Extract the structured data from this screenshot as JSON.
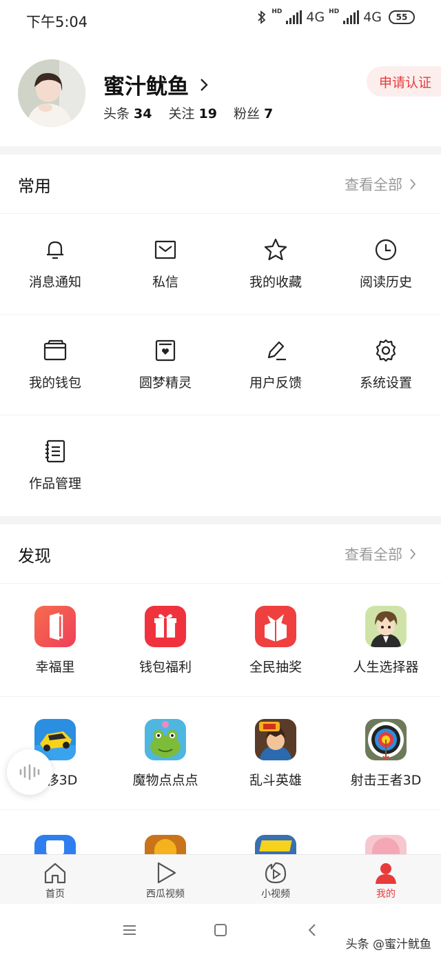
{
  "status_bar": {
    "time": "下午5:04",
    "hd1": "HD",
    "net1": "4G",
    "hd2": "HD",
    "net2": "4G",
    "battery": "55"
  },
  "profile": {
    "name": "蜜汁鱿鱼",
    "verify_label": "申请认证",
    "stats": [
      {
        "label": "头条",
        "value": "34"
      },
      {
        "label": "关注",
        "value": "19"
      },
      {
        "label": "粉丝",
        "value": "7"
      }
    ]
  },
  "common": {
    "title": "常用",
    "view_all": "查看全部",
    "items": [
      {
        "label": "消息通知",
        "icon": "bell-icon"
      },
      {
        "label": "私信",
        "icon": "mail-icon"
      },
      {
        "label": "我的收藏",
        "icon": "star-icon"
      },
      {
        "label": "阅读历史",
        "icon": "clock-icon"
      },
      {
        "label": "我的钱包",
        "icon": "wallet-icon"
      },
      {
        "label": "圆梦精灵",
        "icon": "heart-box-icon"
      },
      {
        "label": "用户反馈",
        "icon": "pen-icon"
      },
      {
        "label": "系统设置",
        "icon": "gear-icon"
      },
      {
        "label": "作品管理",
        "icon": "notebook-icon"
      }
    ]
  },
  "discover": {
    "title": "发现",
    "view_all": "查看全部",
    "apps": [
      {
        "label": "幸福里",
        "icon": "door-app-icon",
        "color": "#f0564a"
      },
      {
        "label": "钱包福利",
        "icon": "gift-app-icon",
        "color": "#f0323e"
      },
      {
        "label": "全民抽奖",
        "icon": "box-app-icon",
        "color": "#ef3f3f"
      },
      {
        "label": "人生选择器",
        "icon": "anime-boy-app-icon",
        "color": "#d9c37a"
      },
      {
        "label": "漂移3D",
        "icon": "race-car-app-icon",
        "color": "#2a8fe0"
      },
      {
        "label": "魔物点点点",
        "icon": "frog-monster-app-icon",
        "color": "#4fb6e0"
      },
      {
        "label": "乱斗英雄",
        "icon": "hero-app-icon",
        "color": "#7a4a2e"
      },
      {
        "label": "射击王者3D",
        "icon": "target-app-icon",
        "color": "#6c7a5a"
      }
    ],
    "partial_row_colors": [
      "#2e7ef0",
      "#c9731a",
      "#3a6fb0",
      "#f6c7cf"
    ]
  },
  "tabs": [
    {
      "label": "首页",
      "icon": "home-icon"
    },
    {
      "label": "西瓜视频",
      "icon": "play-icon"
    },
    {
      "label": "小视频",
      "icon": "short-video-icon"
    },
    {
      "label": "我的",
      "icon": "person-icon",
      "active": true
    }
  ],
  "watermark": "头条 @蜜汁鱿鱼",
  "colors": {
    "accent": "#e83b3b"
  }
}
